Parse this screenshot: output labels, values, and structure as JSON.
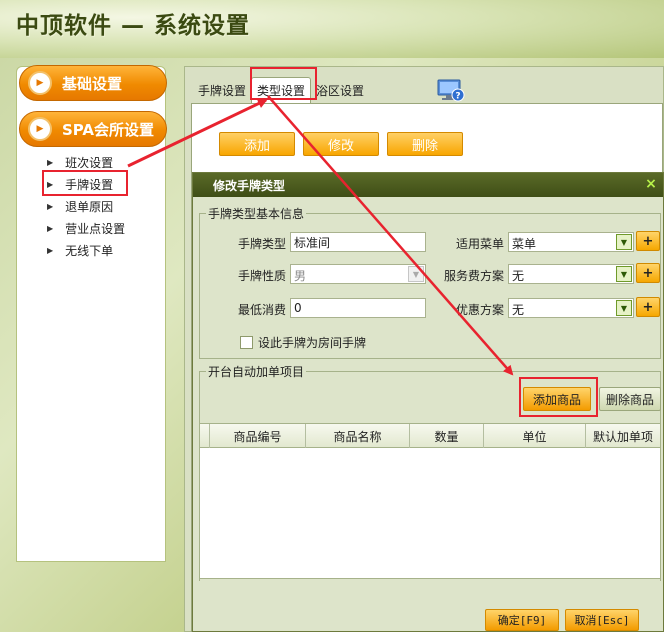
{
  "app": {
    "title": "中顶软件 — 系统设置"
  },
  "sidebar": {
    "buttons": [
      {
        "label": "基础设置"
      },
      {
        "label": "SPA会所设置"
      }
    ],
    "items": [
      {
        "label": "班次设置"
      },
      {
        "label": "手牌设置"
      },
      {
        "label": "退单原因"
      },
      {
        "label": "营业点设置"
      },
      {
        "label": "无线下单"
      }
    ]
  },
  "tabs": [
    {
      "label": "手牌设置"
    },
    {
      "label": "类型设置"
    },
    {
      "label": "浴区设置"
    }
  ],
  "toolbar": {
    "add_label": "添加",
    "edit_label": "修改",
    "delete_label": "删除"
  },
  "dialog": {
    "title": "修改手牌类型",
    "close_glyph": "×",
    "basic_group": {
      "title": "手牌类型基本信息",
      "type_label": "手牌类型",
      "type_value": "标准间",
      "gender_label": "手牌性质",
      "gender_value": "男",
      "min_label": "最低消费",
      "min_value": "0",
      "menu_label": "适用菜单",
      "menu_value": "菜单",
      "service_label": "服务费方案",
      "service_value": "无",
      "discount_label": "优惠方案",
      "discount_value": "无",
      "room_checkbox_label": "设此手牌为房间手牌",
      "plus_glyph": "+"
    },
    "auto_group": {
      "title": "开台自动加单项目",
      "add_goods_label": "添加商品",
      "delete_goods_label": "删除商品",
      "columns": [
        "商品编号",
        "商品名称",
        "数量",
        "单位",
        "默认加单项"
      ]
    },
    "ok_label": "确定[F9]",
    "cancel_label": "取消[Esc]"
  },
  "colors": {
    "accent_orange": "#f39b00",
    "highlight_red": "#e8232f",
    "dialog_title_bg": "#4b5a1e"
  }
}
